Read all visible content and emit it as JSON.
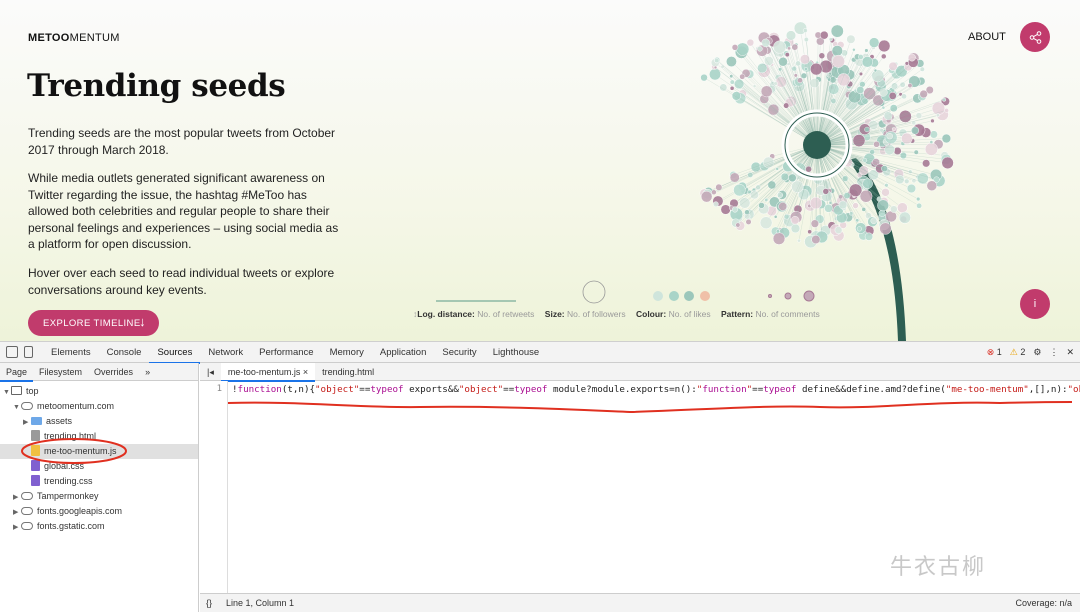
{
  "site": {
    "logo_bold": "METOO",
    "logo_rest": "MENTUM",
    "about": "ABOUT",
    "title": "Trending seeds",
    "para1": "Trending seeds are the most popular tweets from October 2017 through March 2018.",
    "para2": "While media outlets generated significant awareness on Twitter regarding the issue, the hashtag #MeToo has allowed both celebrities and regular people to share their personal feelings and experiences – using social media as a platform for open discussion.",
    "para3": "Hover over each seed to read individual tweets or explore conversations around key events.",
    "explore_label": "EXPLORE TIMELINE",
    "explore_arrow": "↓",
    "info_label": "i",
    "controls": {
      "log_label": "Log. distance:",
      "log_value": "No. of retweets",
      "size_label": "Size:",
      "size_value": "No. of followers",
      "colour_label": "Colour:",
      "colour_value": "No. of likes",
      "pattern_label": "Pattern:",
      "pattern_value": "No. of comments"
    },
    "accent": "#c13b6c"
  },
  "devtools": {
    "tabs": [
      "Elements",
      "Console",
      "Sources",
      "Network",
      "Performance",
      "Memory",
      "Application",
      "Security",
      "Lighthouse"
    ],
    "active_tab": "Sources",
    "errors": "1",
    "warnings": "2",
    "nav_tabs": [
      "Page",
      "Filesystem",
      "Overrides",
      "»"
    ],
    "tree": [
      {
        "label": "top",
        "icon": "frame",
        "depth": 0,
        "arrow": "▼"
      },
      {
        "label": "metoomentum.com",
        "icon": "cloud",
        "depth": 1,
        "arrow": "▼"
      },
      {
        "label": "assets",
        "icon": "folder",
        "depth": 2,
        "arrow": "▶"
      },
      {
        "label": "trending.html",
        "icon": "html",
        "depth": 2,
        "arrow": ""
      },
      {
        "label": "me-too-mentum.js",
        "icon": "js",
        "depth": 2,
        "arrow": "",
        "selected": true
      },
      {
        "label": "global.css",
        "icon": "css",
        "depth": 2,
        "arrow": ""
      },
      {
        "label": "trending.css",
        "icon": "css",
        "depth": 2,
        "arrow": ""
      },
      {
        "label": "Tampermonkey",
        "icon": "cloud",
        "depth": 1,
        "arrow": "▶"
      },
      {
        "label": "fonts.googleapis.com",
        "icon": "cloud",
        "depth": 1,
        "arrow": "▶"
      },
      {
        "label": "fonts.gstatic.com",
        "icon": "cloud",
        "depth": 1,
        "arrow": "▶"
      }
    ],
    "editor_tabs": [
      "me-too-mentum.js ×",
      "trending.html"
    ],
    "line_number": "1",
    "code_line": "!function(t,n){\"object\"==typeof exports&&\"object\"==typeof module?module.exports=n():\"function\"==typeof define&&define.amd?define(\"me-too-mentum\",[],n):\"object",
    "status_left": "{}",
    "status_pos": "Line 1, Column 1",
    "status_coverage": "Coverage: n/a"
  },
  "watermark": "牛衣古柳"
}
